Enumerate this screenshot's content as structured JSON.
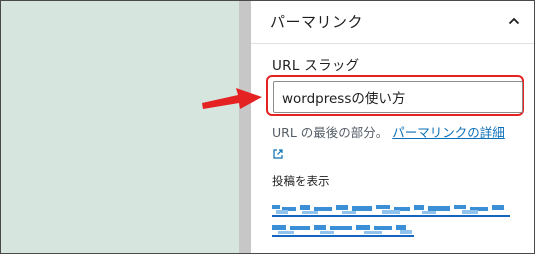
{
  "panel": {
    "title": "パーマリンク",
    "toggle_icon": "chevron-up-icon",
    "slug_label": "URL スラッグ",
    "slug_value": "wordpressの使い方",
    "help_text": "URL の最後の部分。",
    "help_link": "パーマリンクの詳細",
    "external_icon": "external-link-icon",
    "view_post_label": "投稿を表示"
  },
  "annotation": {
    "arrow_color": "#e52222",
    "highlight_color": "#e52222"
  },
  "colors": {
    "left_background": "#d6e6df",
    "divider": "#c7c7c7",
    "link": "#0a6fb8"
  }
}
